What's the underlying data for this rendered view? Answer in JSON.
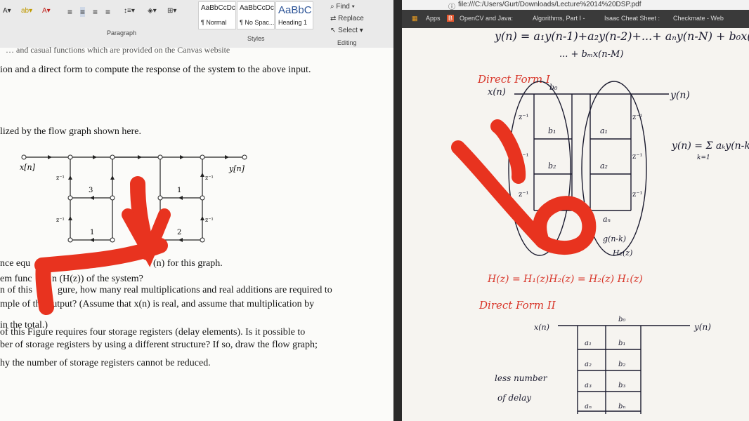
{
  "word": {
    "ribbon": {
      "styles": [
        {
          "sample": "AaBbCcDc",
          "name": "¶ Normal"
        },
        {
          "sample": "AaBbCcDc",
          "name": "¶ No Spac..."
        },
        {
          "sample": "AaBbC",
          "name": "Heading 1"
        }
      ],
      "find": "Find",
      "replace": "Replace",
      "select": "Select",
      "group_paragraph": "Paragraph",
      "group_styles": "Styles",
      "group_editing": "Editing"
    },
    "doc": {
      "line_partial_top": "… and casual functions which are provided on the Canvas website",
      "line1": "ion and a direct form to compute the response of the system to the above input.",
      "line2": "lized by the flow graph shown here.",
      "graph": {
        "x_label": "x[n]",
        "y_label": "y[n]",
        "z_label": "z⁻¹",
        "coef_3": "3",
        "coef_1a": "1",
        "coef_1b": "1",
        "coef_2": "2"
      },
      "q1": "nce equ",
      "q1_tail": "(n) for this graph.",
      "q2": "em func",
      "q2_tail": "n (H(z)) of the system?",
      "q3": "n of this",
      "q3_tail": "gure, how many real multiplications and real additions are required to",
      "q4": "mple of the output? (Assume that x(n) is real, and assume that multiplication by",
      "q5": "in the total.)",
      "q6": "of this Figure requires four storage registers (delay elements). Is it possible to",
      "q7": "ber of storage registers by using a different structure? If so, draw the flow graph;",
      "q8": "hy the number of storage registers cannot be reduced."
    }
  },
  "browser": {
    "address": "file:///C:/Users/Gurt/Downloads/Lecture%2014%20DSP.pdf",
    "bookmarks": [
      "Apps",
      "OpenCV and Java:",
      "Algorithms, Part I -",
      "Isaac Cheat Sheet :",
      "Checkmate - Web"
    ]
  },
  "notes": {
    "eq_top": "y(n) = a₁y(n-1)+a₂y(n-2)+...+ aₙy(n-N) + b₀x(n)+",
    "eq_top2": "... + bₘx(n-M)",
    "direct_form_1": "Direct Form I",
    "xn": "x(n)",
    "yn": "y(n)",
    "b0": "b₀",
    "b1": "b₁",
    "b2": "b₂",
    "bm": "bₘ",
    "a1": "a₁",
    "a2": "a₂",
    "aN": "aₙ",
    "sum_eq": "y(n) = Σ aₖy(n-k)",
    "sum_limits": "k=1",
    "g_label": "g(n-k)",
    "h2": "H₂(z)",
    "hz_eq": "H(z) = H₁(z)H₂(z) = H₂(z) H₁(z)",
    "direct_form_2": "Direct Form II",
    "df2_b0": "b₀",
    "df2_b1": "b₁",
    "df2_b2": "b₂",
    "df2_b3": "b₃",
    "df2_bn": "bₙ",
    "df2_a1": "a₁",
    "df2_a2": "a₂",
    "df2_a3": "a₃",
    "df2_an": "aₙ",
    "less1": "less number",
    "less2": "of delay",
    "z_inv": "z⁻¹"
  },
  "colors": {
    "annotation_red": "#e8331f",
    "ink": "#1a1a2e",
    "note_red": "#d8362a"
  }
}
